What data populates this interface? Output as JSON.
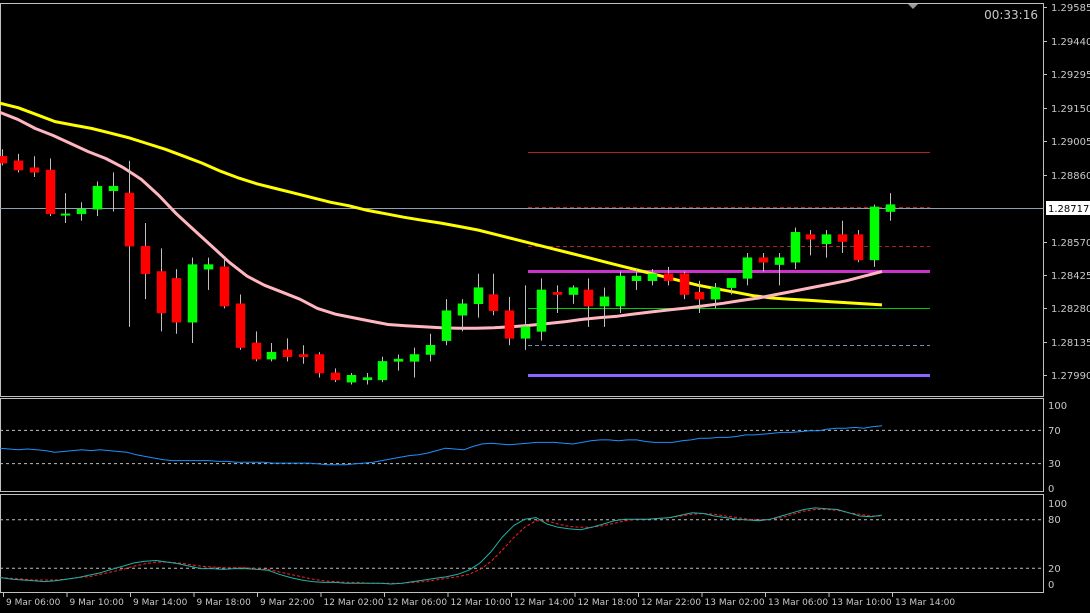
{
  "timer": "00:33:16",
  "colors": {
    "background": "#000000",
    "frame": "#c0c0c0",
    "text": "#c8c8c8",
    "bull": "#00ff00",
    "bear": "#ff0000",
    "wick": "#c0c0c0",
    "ma_slow": "#ffff00",
    "ma_fast": "#ffb6c1",
    "rsi": "#1e90ff",
    "stoch_main": "#20b2aa",
    "stoch_signal": "#ff2020",
    "bid_line": "#8fa0b0"
  },
  "chart_data": [
    {
      "type": "candlestick",
      "ylim": [
        1.279,
        1.296
      ],
      "y_ticks": [
        "1.29585",
        "1.29440",
        "1.29295",
        "1.29150",
        "1.29005",
        "1.28860",
        "1.28717",
        "1.28570",
        "1.28425",
        "1.28280",
        "1.28135",
        "1.27990"
      ],
      "current_price": "1.28717",
      "x_labels": [
        "9 Mar 06:00",
        "9 Mar 10:00",
        "9 Mar 14:00",
        "9 Mar 18:00",
        "9 Mar 22:00",
        "12 Mar 02:00",
        "12 Mar 06:00",
        "12 Mar 10:00",
        "12 Mar 14:00",
        "12 Mar 18:00",
        "12 Mar 22:00",
        "13 Mar 02:00",
        "13 Mar 06:00",
        "13 Mar 10:00",
        "13 Mar 14:00"
      ],
      "candles": [
        {
          "o": 1.2894,
          "h": 1.2897,
          "l": 1.289,
          "c": 1.2891
        },
        {
          "o": 1.2892,
          "h": 1.2895,
          "l": 1.2887,
          "c": 1.2888
        },
        {
          "o": 1.2889,
          "h": 1.2894,
          "l": 1.2885,
          "c": 1.2887
        },
        {
          "o": 1.2888,
          "h": 1.2893,
          "l": 1.2868,
          "c": 1.2869
        },
        {
          "o": 1.2869,
          "h": 1.2878,
          "l": 1.2865,
          "c": 1.2869
        },
        {
          "o": 1.2869,
          "h": 1.2874,
          "l": 1.2866,
          "c": 1.2871
        },
        {
          "o": 1.2871,
          "h": 1.2883,
          "l": 1.2868,
          "c": 1.2881
        },
        {
          "o": 1.2879,
          "h": 1.2887,
          "l": 1.287,
          "c": 1.2881
        },
        {
          "o": 1.2878,
          "h": 1.2892,
          "l": 1.282,
          "c": 1.2855
        },
        {
          "o": 1.2855,
          "h": 1.2865,
          "l": 1.2832,
          "c": 1.2843
        },
        {
          "o": 1.2844,
          "h": 1.2854,
          "l": 1.2818,
          "c": 1.2826
        },
        {
          "o": 1.2841,
          "h": 1.2845,
          "l": 1.2817,
          "c": 1.2822
        },
        {
          "o": 1.2822,
          "h": 1.285,
          "l": 1.2813,
          "c": 1.2847
        },
        {
          "o": 1.2845,
          "h": 1.285,
          "l": 1.2836,
          "c": 1.2847
        },
        {
          "o": 1.2846,
          "h": 1.285,
          "l": 1.2828,
          "c": 1.2829
        },
        {
          "o": 1.283,
          "h": 1.2834,
          "l": 1.281,
          "c": 1.2811
        },
        {
          "o": 1.2813,
          "h": 1.2818,
          "l": 1.2805,
          "c": 1.2806
        },
        {
          "o": 1.2806,
          "h": 1.2813,
          "l": 1.2805,
          "c": 1.2809
        },
        {
          "o": 1.281,
          "h": 1.2815,
          "l": 1.2805,
          "c": 1.2807
        },
        {
          "o": 1.2808,
          "h": 1.2812,
          "l": 1.2804,
          "c": 1.2807
        },
        {
          "o": 1.2808,
          "h": 1.2809,
          "l": 1.2798,
          "c": 1.28
        },
        {
          "o": 1.28,
          "h": 1.2802,
          "l": 1.2796,
          "c": 1.2797
        },
        {
          "o": 1.2796,
          "h": 1.28,
          "l": 1.2795,
          "c": 1.2799
        },
        {
          "o": 1.2797,
          "h": 1.28,
          "l": 1.2795,
          "c": 1.2798
        },
        {
          "o": 1.2797,
          "h": 1.2807,
          "l": 1.2796,
          "c": 1.2805
        },
        {
          "o": 1.2805,
          "h": 1.2808,
          "l": 1.2801,
          "c": 1.2806
        },
        {
          "o": 1.2805,
          "h": 1.2811,
          "l": 1.2798,
          "c": 1.2808
        },
        {
          "o": 1.2808,
          "h": 1.2817,
          "l": 1.2805,
          "c": 1.2812
        },
        {
          "o": 1.2814,
          "h": 1.2832,
          "l": 1.2812,
          "c": 1.2827
        },
        {
          "o": 1.2825,
          "h": 1.2832,
          "l": 1.2818,
          "c": 1.283
        },
        {
          "o": 1.283,
          "h": 1.2843,
          "l": 1.2824,
          "c": 1.2837
        },
        {
          "o": 1.2834,
          "h": 1.2843,
          "l": 1.2825,
          "c": 1.2827
        },
        {
          "o": 1.2827,
          "h": 1.2833,
          "l": 1.2812,
          "c": 1.2815
        },
        {
          "o": 1.2815,
          "h": 1.2838,
          "l": 1.281,
          "c": 1.282
        },
        {
          "o": 1.2818,
          "h": 1.2841,
          "l": 1.2814,
          "c": 1.2836
        },
        {
          "o": 1.2835,
          "h": 1.2838,
          "l": 1.2826,
          "c": 1.2834
        },
        {
          "o": 1.2834,
          "h": 1.2838,
          "l": 1.283,
          "c": 1.2837
        },
        {
          "o": 1.2836,
          "h": 1.2841,
          "l": 1.282,
          "c": 1.2829
        },
        {
          "o": 1.2829,
          "h": 1.2837,
          "l": 1.282,
          "c": 1.2833
        },
        {
          "o": 1.2829,
          "h": 1.2844,
          "l": 1.2826,
          "c": 1.2842
        },
        {
          "o": 1.284,
          "h": 1.2845,
          "l": 1.2836,
          "c": 1.2842
        },
        {
          "o": 1.284,
          "h": 1.2845,
          "l": 1.2838,
          "c": 1.2843
        },
        {
          "o": 1.2843,
          "h": 1.2846,
          "l": 1.2838,
          "c": 1.284
        },
        {
          "o": 1.2843,
          "h": 1.2844,
          "l": 1.2832,
          "c": 1.2834
        },
        {
          "o": 1.2835,
          "h": 1.284,
          "l": 1.2826,
          "c": 1.2832
        },
        {
          "o": 1.2832,
          "h": 1.2839,
          "l": 1.2828,
          "c": 1.2837
        },
        {
          "o": 1.2837,
          "h": 1.2841,
          "l": 1.2834,
          "c": 1.2841
        },
        {
          "o": 1.2841,
          "h": 1.2852,
          "l": 1.2838,
          "c": 1.285
        },
        {
          "o": 1.285,
          "h": 1.2852,
          "l": 1.2844,
          "c": 1.2848
        },
        {
          "o": 1.2847,
          "h": 1.2852,
          "l": 1.2838,
          "c": 1.285
        },
        {
          "o": 1.2848,
          "h": 1.2863,
          "l": 1.2845,
          "c": 1.2861
        },
        {
          "o": 1.286,
          "h": 1.2862,
          "l": 1.2851,
          "c": 1.2858
        },
        {
          "o": 1.2856,
          "h": 1.2862,
          "l": 1.285,
          "c": 1.286
        },
        {
          "o": 1.286,
          "h": 1.2866,
          "l": 1.2852,
          "c": 1.2857
        },
        {
          "o": 1.286,
          "h": 1.2862,
          "l": 1.2848,
          "c": 1.2849
        },
        {
          "o": 1.2849,
          "h": 1.2873,
          "l": 1.2846,
          "c": 1.2872
        },
        {
          "o": 1.287,
          "h": 1.2878,
          "l": 1.2866,
          "c": 1.2873
        }
      ],
      "ma_slow": [
        1.2917,
        1.2915,
        1.2912,
        1.2909,
        1.29075,
        1.2906,
        1.2904,
        1.2902,
        1.28995,
        1.2897,
        1.2894,
        1.2891,
        1.28875,
        1.28845,
        1.2882,
        1.288,
        1.2878,
        1.2876,
        1.2874,
        1.28725,
        1.28705,
        1.2869,
        1.28675,
        1.28662,
        1.2865,
        1.28635,
        1.2862,
        1.286,
        1.2858,
        1.2856,
        1.2854,
        1.2852,
        1.285,
        1.2848,
        1.2846,
        1.2844,
        1.2842,
        1.284,
        1.2838,
        1.28365,
        1.2835,
        1.28335,
        1.28325,
        1.2832,
        1.28315,
        1.2831,
        1.28305,
        1.283,
        1.28295
      ],
      "ma_fast": [
        1.2913,
        1.291,
        1.2906,
        1.2903,
        1.28995,
        1.2896,
        1.2893,
        1.2889,
        1.2884,
        1.2877,
        1.2869,
        1.2862,
        1.2855,
        1.2848,
        1.2842,
        1.2838,
        1.2835,
        1.2832,
        1.2828,
        1.28255,
        1.2824,
        1.28225,
        1.2821,
        1.28205,
        1.282,
        1.28196,
        1.28194,
        1.28194,
        1.28196,
        1.282,
        1.28206,
        1.28214,
        1.28222,
        1.28232,
        1.2824,
        1.28246,
        1.28256,
        1.28265,
        1.28274,
        1.28282,
        1.28292,
        1.28302,
        1.28314,
        1.28325,
        1.2834,
        1.28355,
        1.2837,
        1.28385,
        1.284,
        1.2842,
        1.2844
      ],
      "levels": [
        {
          "price": 1.2896,
          "color": "#b22222",
          "style": "solid"
        },
        {
          "price": 1.2872,
          "color": "#b22222",
          "style": "dashed"
        },
        {
          "price": 1.2855,
          "color": "#b22222",
          "style": "dashed"
        },
        {
          "price": 1.2844,
          "color": "#cc33cc",
          "style": "thick"
        },
        {
          "price": 1.2828,
          "color": "#00cc00",
          "style": "solid"
        },
        {
          "price": 1.2812,
          "color": "#6f8fbf",
          "style": "dashed"
        },
        {
          "price": 1.2799,
          "color": "#8866ff",
          "style": "thick"
        }
      ]
    },
    {
      "type": "line",
      "ylim": [
        0,
        100
      ],
      "y_ticks": [
        "100",
        "70",
        "30",
        "0"
      ],
      "levels": [
        70,
        30
      ],
      "values": [
        48,
        47,
        46,
        47,
        46,
        45,
        43,
        44,
        45,
        46,
        45,
        46,
        45,
        44,
        43,
        40,
        38,
        36,
        34,
        33,
        33,
        33,
        33,
        33,
        32,
        32,
        31,
        31,
        31,
        31,
        30,
        30,
        30,
        30,
        30,
        29,
        28,
        28,
        28,
        29,
        30,
        31,
        33,
        35,
        37,
        39,
        40,
        42,
        45,
        48,
        47,
        46,
        50,
        53,
        54,
        53,
        52,
        53,
        54,
        55,
        55,
        55,
        54,
        53,
        55,
        57,
        58,
        58,
        57,
        58,
        58,
        56,
        55,
        55,
        55,
        57,
        58,
        60,
        60,
        61,
        61,
        62,
        64,
        64,
        65,
        66,
        67,
        67,
        68,
        69,
        69,
        71,
        72,
        72,
        73,
        72,
        74,
        75
      ]
    },
    {
      "type": "line",
      "ylim": [
        0,
        100
      ],
      "y_ticks": [
        "100",
        "80",
        "20",
        "0"
      ],
      "levels": [
        80,
        20
      ],
      "series": [
        {
          "values": [
            8,
            6,
            5,
            4,
            3,
            4,
            6,
            8,
            11,
            14,
            18,
            22,
            26,
            28,
            29,
            27,
            25,
            22,
            19,
            19,
            18,
            19,
            19,
            18,
            17,
            12,
            8,
            5,
            3,
            2,
            2,
            1,
            1,
            1,
            1,
            0,
            1,
            3,
            5,
            7,
            9,
            12,
            17,
            26,
            40,
            58,
            72,
            80,
            82,
            74,
            70,
            68,
            67,
            70,
            74,
            78,
            80,
            80,
            80,
            81,
            82,
            85,
            88,
            87,
            84,
            82,
            80,
            79,
            78,
            80,
            84,
            88,
            92,
            94,
            93,
            92,
            88,
            84,
            83,
            85
          ]
        },
        {
          "values": [
            8,
            7,
            6,
            5,
            5,
            5,
            6,
            8,
            9,
            12,
            15,
            18,
            22,
            25,
            27,
            27,
            26,
            24,
            22,
            21,
            20,
            20,
            20,
            19,
            18,
            15,
            12,
            9,
            6,
            4,
            3,
            2,
            2,
            1,
            1,
            1,
            1,
            2,
            3,
            5,
            7,
            9,
            12,
            18,
            28,
            42,
            57,
            70,
            78,
            78,
            74,
            71,
            70,
            70,
            72,
            75,
            78,
            80,
            80,
            81,
            82,
            84,
            86,
            87,
            86,
            84,
            82,
            80,
            79,
            80,
            82,
            86,
            90,
            92,
            92,
            91,
            88,
            86,
            84,
            84
          ]
        }
      ]
    }
  ]
}
